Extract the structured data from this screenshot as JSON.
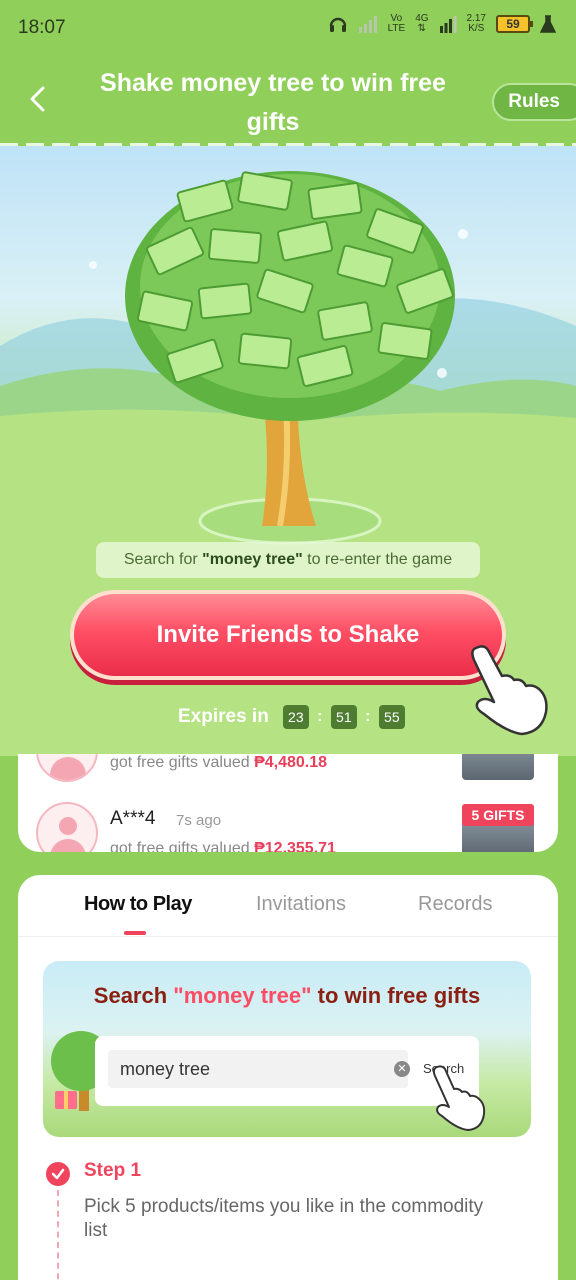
{
  "status_bar": {
    "time": "18:07",
    "network_vo": "Vo",
    "network_lte": "LTE",
    "network_4g": "4G",
    "speed_value": "2.17",
    "speed_unit": "K/S",
    "battery": "59"
  },
  "header": {
    "title": "Shake money tree to win free gifts",
    "rules_label": "Rules"
  },
  "scene": {
    "hint_prefix": "Search for ",
    "hint_keyword": "\"money tree\"",
    "hint_suffix": " to re-enter the game",
    "invite_label": "Invite Friends to Shake",
    "expires_label": "Expires in",
    "timer": {
      "hours": "23",
      "minutes": "51",
      "seconds": "55"
    }
  },
  "winners": [
    {
      "name": "",
      "time": "",
      "gift_prefix": "got free gifts valued ",
      "gift_value": "₱4,480.18",
      "badge": ""
    },
    {
      "name": "A***4",
      "time": "7s ago",
      "gift_prefix": "got free gifts valued ",
      "gift_value": "₱12,355.71",
      "badge": "5 GIFTS"
    }
  ],
  "tabs": [
    {
      "label": "How to Play",
      "active": true
    },
    {
      "label": "Invitations",
      "active": false
    },
    {
      "label": "Records",
      "active": false
    }
  ],
  "banner": {
    "title_prefix": "Search ",
    "title_keyword": "\"money tree\"",
    "title_suffix": " to win free gifts",
    "search_value": "money tree",
    "search_button": "Search"
  },
  "steps": [
    {
      "title": "Step 1",
      "description": "Pick 5 products/items you like in the commodity list"
    }
  ],
  "colors": {
    "brand_green": "#8fcf5a",
    "accent_red": "#f0445d"
  }
}
